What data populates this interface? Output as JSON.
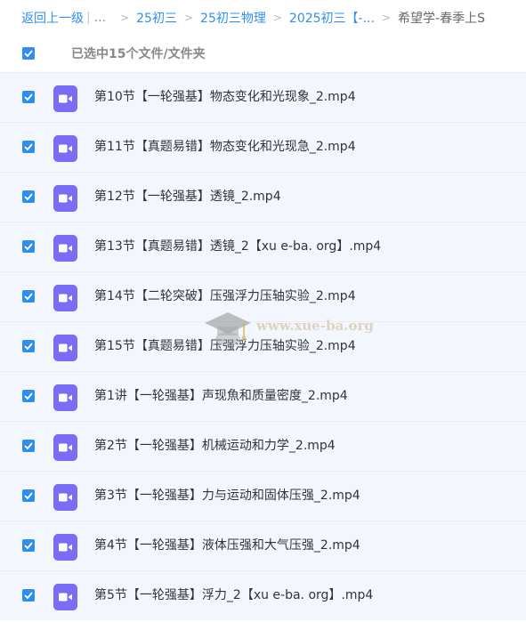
{
  "breadcrumb": {
    "back_label": "返回上一级",
    "ellipsis": "...",
    "items": [
      "25初三",
      "25初三物理",
      "2025初三【-..."
    ],
    "current": "希望学-春季上S"
  },
  "selection": {
    "label": "已选中15个文件/文件夹"
  },
  "files": [
    {
      "name": "第10节【一轮强基】物态变化和光现象_2.mp4",
      "checked": true
    },
    {
      "name": "第11节【真题易错】物态变化和光现急_2.mp4",
      "checked": true
    },
    {
      "name": "第12节【一轮强基】透镜_2.mp4",
      "checked": true
    },
    {
      "name": "第13节【真题易错】透镜_2【xu e-ba. org】.mp4",
      "checked": true
    },
    {
      "name": "第14节【二轮突破】压强浮力压轴实验_2.mp4",
      "checked": true
    },
    {
      "name": "第15节【真题易错】压强浮力压轴实验_2.mp4",
      "checked": true
    },
    {
      "name": "第1讲【一轮强基】声现魚和质量密度_2.mp4",
      "checked": true
    },
    {
      "name": "第2节【一轮强基】机械运动和力学_2.mp4",
      "checked": true
    },
    {
      "name": "第3节【一轮强基】力与运动和固体压强_2.mp4",
      "checked": true
    },
    {
      "name": "第4节【一轮强基】液体压强和大气压强_2.mp4",
      "checked": true
    },
    {
      "name": "第5节【一轮强基】浮力_2【xu e-ba. org】.mp4",
      "checked": true
    }
  ],
  "watermark": {
    "text": "www.xue-ba.org",
    "icon": "graduation-cap-icon"
  },
  "colors": {
    "accent": "#2f8ef0",
    "video_icon": "#7b6cf6",
    "row_background": "#f3f7fd"
  }
}
